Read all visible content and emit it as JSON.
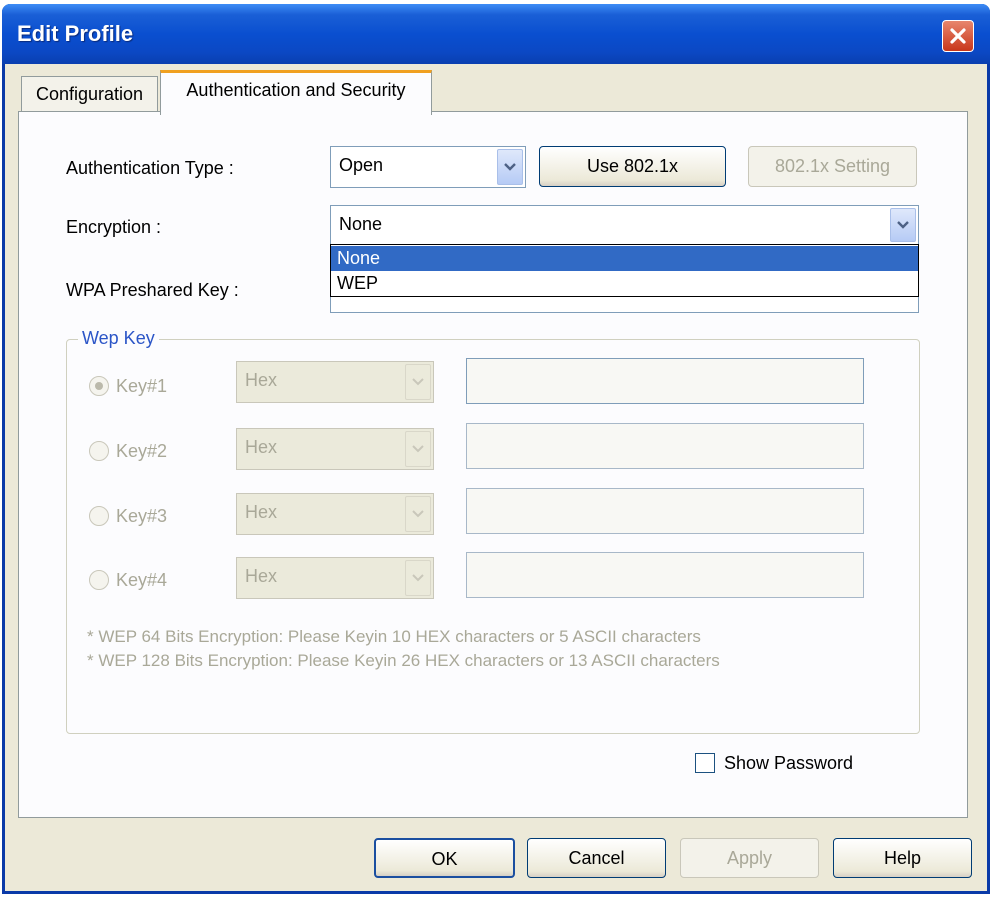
{
  "window": {
    "title": "Edit Profile"
  },
  "tabs": [
    {
      "label": "Configuration",
      "active": false
    },
    {
      "label": "Authentication and Security",
      "active": true
    }
  ],
  "auth": {
    "type_label": "Authentication Type :",
    "type_value": "Open",
    "use8021x_label": "Use 802.1x",
    "setting8021x_label": "802.1x Setting"
  },
  "encryption": {
    "label": "Encryption :",
    "value": "None",
    "options": [
      {
        "label": "None",
        "selected": true
      },
      {
        "label": "WEP",
        "selected": false
      }
    ]
  },
  "wpa": {
    "label": "WPA Preshared Key :"
  },
  "wep": {
    "group_label": "Wep Key",
    "keys": [
      {
        "label": "Key#1",
        "format": "Hex",
        "checked": true
      },
      {
        "label": "Key#2",
        "format": "Hex",
        "checked": false
      },
      {
        "label": "Key#3",
        "format": "Hex",
        "checked": false
      },
      {
        "label": "Key#4",
        "format": "Hex",
        "checked": false
      }
    ],
    "notes": [
      "* WEP 64 Bits Encryption:  Please Keyin 10 HEX characters or 5 ASCII characters",
      "* WEP 128 Bits Encryption:  Please Keyin 26 HEX characters or 13 ASCII characters"
    ]
  },
  "show_password": {
    "label": "Show Password",
    "checked": false
  },
  "buttons": {
    "ok": "OK",
    "cancel": "Cancel",
    "apply": "Apply",
    "help": "Help"
  },
  "colors": {
    "title_bar": "#0a4fd0",
    "dialog_bg": "#ece9d8",
    "selection": "#316ac5",
    "close": "#c8361b",
    "tab_accent": "#f0a020"
  }
}
